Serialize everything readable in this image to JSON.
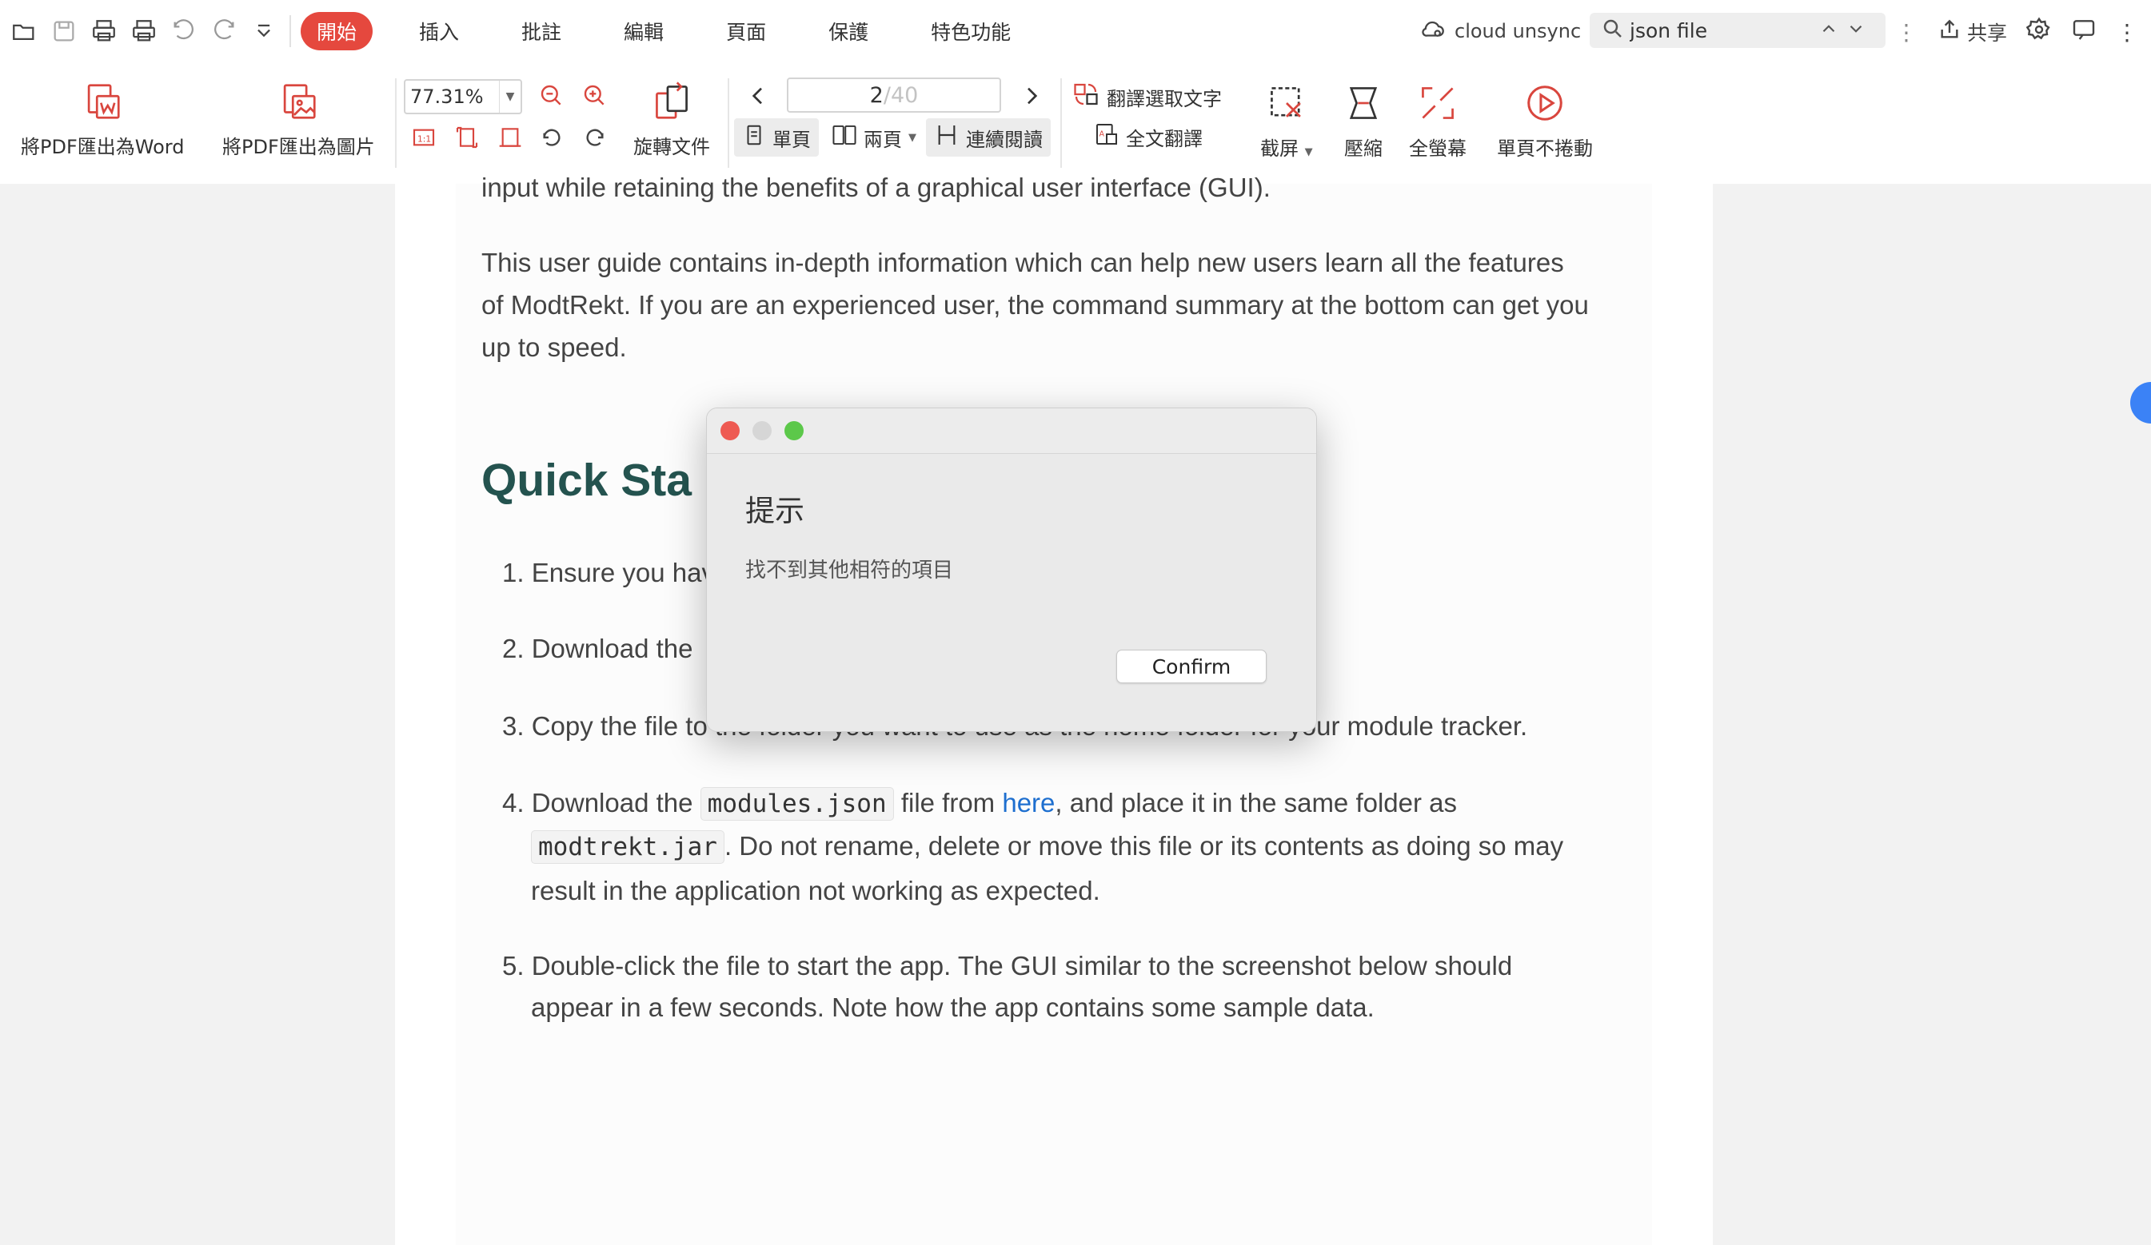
{
  "menubar": {
    "tabs": [
      "開始",
      "插入",
      "批註",
      "編輯",
      "頁面",
      "保護",
      "特色功能"
    ],
    "active_tab": "開始",
    "cloud_status": "cloud unsync",
    "search": {
      "value": "json file"
    },
    "share_label": "共享"
  },
  "ribbon": {
    "export_word": "將PDF匯出為Word",
    "export_image": "將PDF匯出為圖片",
    "zoom": "77.31%",
    "rotate_label": "旋轉文件",
    "page_current": "2",
    "page_total": "/40",
    "mode_single": "單頁",
    "mode_double": "兩頁",
    "mode_continuous": "連續閱讀",
    "translate_selection": "翻譯選取文字",
    "translate_full": "全文翻譯",
    "screenshot": "截屏",
    "compress": "壓縮",
    "fullscreen": "全螢幕",
    "single_no_scroll": "單頁不捲動"
  },
  "document": {
    "line_top": "input while retaining the benefits of a graphical user interface (GUI).",
    "para1_l1": "This user guide contains in-depth information which can help new users learn all the features",
    "para1_l2": "of ModtRekt. If you are an experienced user, the command summary at the bottom can get you",
    "para1_l3": "up to speed.",
    "heading": "Quick Sta",
    "item1": "1. Ensure you hav",
    "item2": "2. Download the",
    "item3": "3. Copy the file to the folder you want to use as the home folder for your module tracker.",
    "item4_a": "4. Download the",
    "item4_code1": "modules.json",
    "item4_b": "file from",
    "item4_link": "here",
    "item4_c": ", and place it in the same folder as",
    "item4_code2": "modtrekt.jar",
    "item4_d": ". Do not rename, delete or move this file or its contents as doing so may",
    "item4_e": "result in the application not working as expected.",
    "item5_l1": "5. Double-click the file to start the app. The GUI similar to the screenshot below should",
    "item5_l2": "appear in a few seconds. Note how the app contains some sample data."
  },
  "dialog": {
    "title": "提示",
    "message": "找不到其他相符的項目",
    "confirm": "Confirm"
  },
  "colors": {
    "accent": "#e5483e",
    "heading": "#24534f",
    "link": "#1e6fcf",
    "close": "#ee5a52",
    "minimize": "#d6d6d6",
    "maximize": "#5cc84a"
  }
}
